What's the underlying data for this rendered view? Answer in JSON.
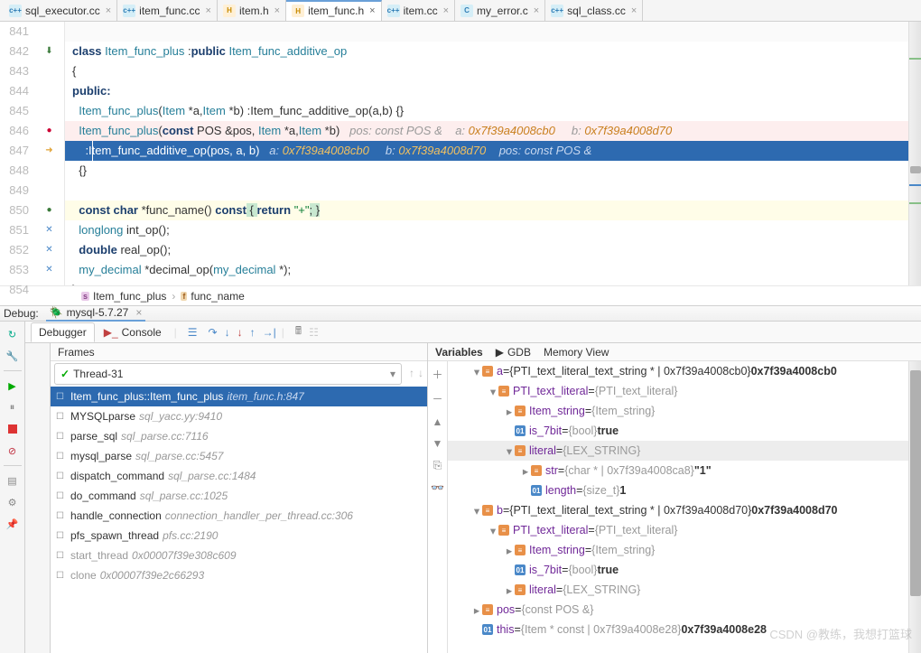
{
  "tabs": [
    {
      "icon": "cpp",
      "label": "sql_executor.cc"
    },
    {
      "icon": "cpp",
      "label": "item_func.cc"
    },
    {
      "icon": "h",
      "label": "item.h"
    },
    {
      "icon": "h",
      "label": "item_func.h",
      "active": true
    },
    {
      "icon": "cpp",
      "label": "item.cc"
    },
    {
      "icon": "c",
      "label": "my_error.c"
    },
    {
      "icon": "cpp",
      "label": "sql_class.cc"
    }
  ],
  "lines": [
    "841",
    "842",
    "843",
    "844",
    "845",
    "846",
    "847",
    "848",
    "849",
    "850",
    "851",
    "852",
    "853",
    "854"
  ],
  "code": {
    "l842_a": "class",
    "l842_b": " Item_func_plus ",
    "l842_c": ":",
    "l842_d": "public",
    "l842_e": " Item_func_additive_op",
    "l843": "{",
    "l844": "public:",
    "l845_a": "  Item_func_plus",
    "l845_b": "(",
    "l845_c": "Item",
    "l845_d": " *a,",
    "l845_e": "Item",
    "l845_f": " *b) :Item_func_additive_op(a,b) {}",
    "l846_a": "  Item_func_plus",
    "l846_b": "(",
    "l846_c": "const",
    "l846_d": " POS &pos, ",
    "l846_e": "Item",
    "l846_f": " *a,",
    "l846_g": "Item",
    "l846_h": " *b)   ",
    "l846_i": "pos: const POS &    a: ",
    "l846_j": "0x7f39a4008cb0",
    "l846_k": "     b: ",
    "l846_l": "0x7f39a4008d70",
    "l847_a": "    :Item_func_additive_op(pos, a, b)   ",
    "l847_b": "a: ",
    "l847_c": "0x7f39a4008cb0",
    "l847_d": "     b: ",
    "l847_e": "0x7f39a4008d70",
    "l847_f": "    pos: const POS &",
    "l848": "  {}",
    "l850_a": "  ",
    "l850_b": "const char",
    "l850_c": " *func_name() ",
    "l850_d": "const",
    "l850_e": " { ",
    "l850_f": "return",
    "l850_g": " ",
    "l850_h": "\"+\"",
    "l850_i": "; }",
    "l851_a": "  ",
    "l851_b": "longlong",
    "l851_c": " int_op();",
    "l852_a": "  ",
    "l852_b": "double",
    "l852_c": " real_op();",
    "l853_a": "  ",
    "l853_b": "my_decimal",
    "l853_c": " *decimal_op(",
    "l853_d": "my_decimal",
    "l853_e": " *);",
    "l854": "};"
  },
  "breadcrumb": {
    "s": "Item_func_plus",
    "f": "func_name"
  },
  "debug": {
    "label": "Debug:",
    "config": "mysql-5.7.27"
  },
  "dtabs": {
    "d": "Debugger",
    "c": "Console"
  },
  "frames": {
    "title": "Frames",
    "thread": "Thread-31",
    "items": [
      {
        "fn": "Item_func_plus::Item_func_plus",
        "loc": "item_func.h:847",
        "sel": true
      },
      {
        "fn": "MYSQLparse",
        "loc": "sql_yacc.yy:9410"
      },
      {
        "fn": "parse_sql",
        "loc": "sql_parse.cc:7116"
      },
      {
        "fn": "mysql_parse",
        "loc": "sql_parse.cc:5457"
      },
      {
        "fn": "dispatch_command",
        "loc": "sql_parse.cc:1484"
      },
      {
        "fn": "do_command",
        "loc": "sql_parse.cc:1025"
      },
      {
        "fn": "handle_connection",
        "loc": "connection_handler_per_thread.cc:306"
      },
      {
        "fn": "pfs_spawn_thread",
        "loc": "pfs.cc:2190"
      },
      {
        "fn": "start_thread",
        "loc": "0x00007f39e308c609",
        "off": true
      },
      {
        "fn": "clone",
        "loc": "0x00007f39e2c66293",
        "off": true
      }
    ]
  },
  "vars": {
    "t1": "Variables",
    "t2": "GDB",
    "t3": "Memory View",
    "tree": [
      {
        "ind": 1,
        "ar": "▾",
        "ic": "p",
        "n": "a",
        "eq": " = ",
        "v": "{PTI_text_literal_text_string * | 0x7f39a4008cb0} ",
        "b": "0x7f39a4008cb0"
      },
      {
        "ind": 2,
        "ar": "▾",
        "ic": "p",
        "n": "PTI_text_literal",
        "eq": " = ",
        "g": "{PTI_text_literal}"
      },
      {
        "ind": 3,
        "ar": "▸",
        "ic": "p",
        "n": "Item_string",
        "eq": " = ",
        "g": "{Item_string}"
      },
      {
        "ind": 3,
        "ar": "",
        "ic": "o",
        "n": "is_7bit",
        "eq": " = ",
        "g": "{bool} ",
        "b": "true"
      },
      {
        "ind": 3,
        "ar": "▾",
        "ic": "p",
        "n": "literal",
        "eq": " = ",
        "g": "{LEX_STRING}",
        "sel": true
      },
      {
        "ind": 4,
        "ar": "▸",
        "ic": "p",
        "n": "str",
        "eq": " = ",
        "g": "{char * | 0x7f39a4008ca8} ",
        "b": "\"1\""
      },
      {
        "ind": 4,
        "ar": "",
        "ic": "o",
        "n": "length",
        "eq": " = ",
        "g": "{size_t} ",
        "b": "1"
      },
      {
        "ind": 1,
        "ar": "▾",
        "ic": "p",
        "n": "b",
        "eq": " = ",
        "v": "{PTI_text_literal_text_string * | 0x7f39a4008d70} ",
        "b": "0x7f39a4008d70"
      },
      {
        "ind": 2,
        "ar": "▾",
        "ic": "p",
        "n": "PTI_text_literal",
        "eq": " = ",
        "g": "{PTI_text_literal}"
      },
      {
        "ind": 3,
        "ar": "▸",
        "ic": "p",
        "n": "Item_string",
        "eq": " = ",
        "g": "{Item_string}"
      },
      {
        "ind": 3,
        "ar": "",
        "ic": "o",
        "n": "is_7bit",
        "eq": " = ",
        "g": "{bool} ",
        "b": "true"
      },
      {
        "ind": 3,
        "ar": "▸",
        "ic": "p",
        "n": "literal",
        "eq": " = ",
        "g": "{LEX_STRING}"
      },
      {
        "ind": 1,
        "ar": "▸",
        "ic": "p",
        "n": "pos",
        "eq": " = ",
        "g": "{const POS &}"
      },
      {
        "ind": 1,
        "ar": "",
        "ic": "o",
        "n": "this",
        "eq": " = ",
        "g": "{Item * const | 0x7f39a4008e28} ",
        "b": "0x7f39a4008e28"
      }
    ]
  },
  "watermark": "CSDN @教练，我想打篮球"
}
